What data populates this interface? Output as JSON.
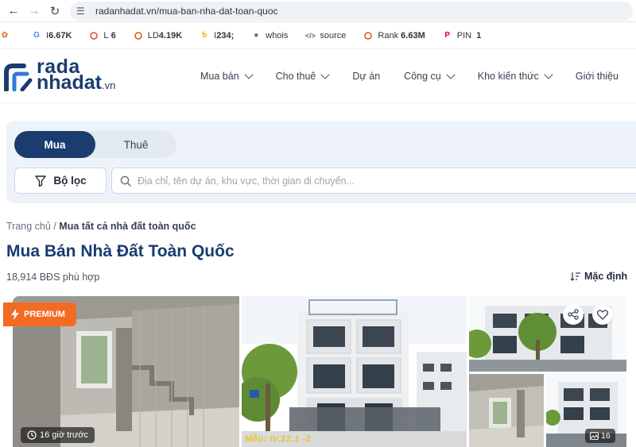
{
  "browser": {
    "url": "radanhadat.vn/mua-ban-nha-dat-toan-quoc",
    "back_icon": "arrow-left-icon",
    "forward_icon": "arrow-right-icon",
    "reload_icon": "reload-icon"
  },
  "extensions": [
    {
      "icon": "google-icon",
      "prefix": "I",
      "value": "6.67K"
    },
    {
      "icon": "circle-icon",
      "prefix": "L",
      "value": "6"
    },
    {
      "icon": "circle-icon",
      "prefix": "LD",
      "value": "4.19K"
    },
    {
      "icon": "bing-icon",
      "prefix": "I",
      "value": "234;"
    },
    {
      "icon": "user-icon",
      "prefix": "",
      "value": "whois"
    },
    {
      "icon": "code-icon",
      "prefix": "",
      "value": "source"
    },
    {
      "icon": "circle-icon",
      "prefix": "Rank",
      "value": "6.63M"
    },
    {
      "icon": "pinterest-icon",
      "prefix": "PIN",
      "value": "1"
    }
  ],
  "logo": {
    "line1": "rada",
    "line2": "nhadat",
    "suffix": ".vn"
  },
  "menu": [
    {
      "label": "Mua bán",
      "has_dropdown": true
    },
    {
      "label": "Cho thuê",
      "has_dropdown": true
    },
    {
      "label": "Dự án",
      "has_dropdown": false
    },
    {
      "label": "Công cụ",
      "has_dropdown": true
    },
    {
      "label": "Kho kiến thức",
      "has_dropdown": true
    },
    {
      "label": "Giới thiệu",
      "has_dropdown": false
    }
  ],
  "search": {
    "tab_buy": "Mua",
    "tab_rent": "Thuê",
    "active_tab": "Mua",
    "filter_label": "Bộ lọc",
    "placeholder": "Địa chỉ, tên dự án, khu vực, thời gian di chuyển..."
  },
  "breadcrumb": {
    "home": "Trang chủ",
    "separator": "/",
    "current": "Mua tất cả nhà đất toàn quốc"
  },
  "page_title": "Mua Bán Nhà Đất Toàn Quốc",
  "result_count": "18,914 BĐS phù hợp",
  "sort_label": "Mặc định",
  "listing": {
    "premium_label": "PREMIUM",
    "time_label": "16 giờ trước",
    "photo_count": "16",
    "watermark": "Mẫu: IV.12.1 -2"
  },
  "colors": {
    "brand": "#1a3c6e",
    "premium": "#f26b21",
    "panel": "#eef3fa"
  }
}
